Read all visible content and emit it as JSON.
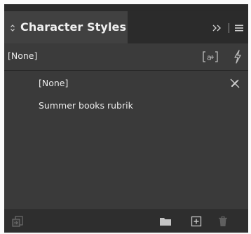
{
  "panel": {
    "title": "Character Styles",
    "header_row": {
      "label": "[None]"
    },
    "styles": [
      {
        "label": "[None]",
        "icon": "no-edit-icon"
      },
      {
        "label": "Summer books rubrik"
      }
    ],
    "icons": {
      "collapse": "collapse-arrows-icon",
      "expand": "expand-panel-icon",
      "menu": "panel-menu-icon",
      "create_from_selection": "brackets-a-icon",
      "clear_overrides": "lightning-icon",
      "load_styles": "load-styles-icon",
      "new_group": "folder-icon",
      "new_style": "new-style-icon",
      "delete": "trash-icon"
    }
  },
  "colors": {
    "panel_bg": "#323232",
    "tab_bg": "#414141",
    "header_row_bg": "#3b3b3b",
    "list_bg": "#3a3a3a",
    "text": "#e8e8e8",
    "icon_dim": "#6e6e6e"
  }
}
